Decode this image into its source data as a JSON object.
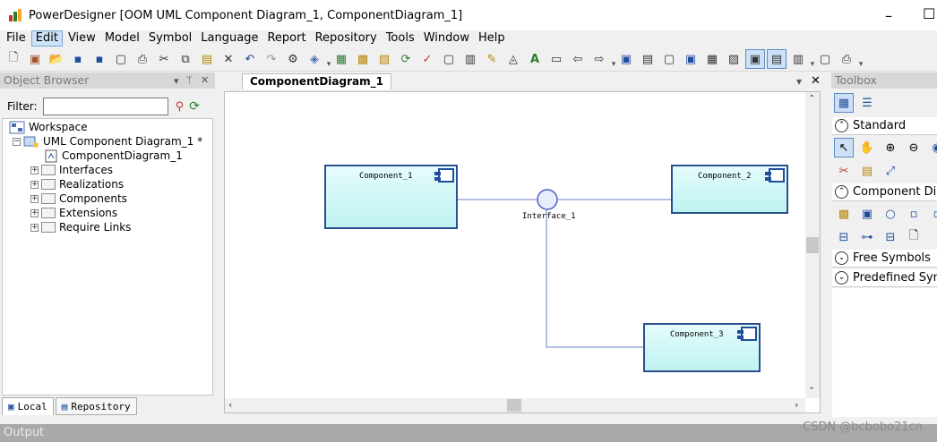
{
  "window": {
    "title": "PowerDesigner [OOM UML Component Diagram_1, ComponentDiagram_1]",
    "minimize": "–",
    "close": "✕"
  },
  "menu": [
    "File",
    "Edit",
    "View",
    "Model",
    "Symbol",
    "Language",
    "Report",
    "Repository",
    "Tools",
    "Window",
    "Help"
  ],
  "menu_active": "Edit",
  "object_browser": {
    "title": "Object Browser",
    "filter_label": "Filter:",
    "filter_value": "",
    "tree": {
      "workspace": "Workspace",
      "model": "UML Component Diagram_1 *",
      "diagram": "ComponentDiagram_1",
      "folders": [
        "Interfaces",
        "Realizations",
        "Components",
        "Extensions",
        "Require Links"
      ]
    },
    "tabs": {
      "local": "Local",
      "repository": "Repository"
    }
  },
  "editor": {
    "tab": "ComponentDiagram_1",
    "components": [
      "Component_1",
      "Component_2",
      "Component_3"
    ],
    "interface": "Interface_1"
  },
  "toolbox": {
    "title": "Toolbox",
    "sections": [
      "Standard",
      "Component Diagram",
      "Free Symbols",
      "Predefined Symbols"
    ]
  },
  "output": {
    "title": "Output"
  },
  "watermark": "CSDN @bcbobo21cn",
  "colors": {
    "component_fill": "#cbf5f5",
    "component_border": "#2b4f8c",
    "link": "#6a7fd0",
    "selection": "#cde0f5"
  }
}
